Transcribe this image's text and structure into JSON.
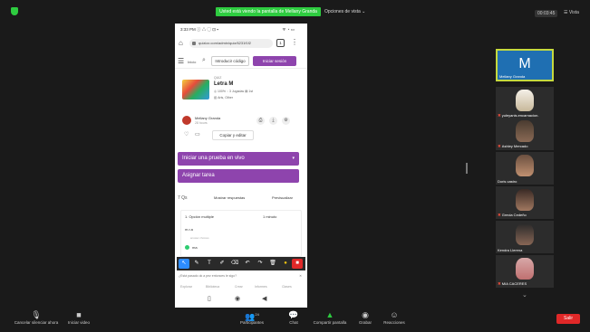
{
  "topbar": {
    "banner": "Usted está viendo la pantalla de Mellany Granda",
    "view_options": "Opciones de vista ⌄",
    "clock": "00:03:45",
    "view_btn": "☰ Vista"
  },
  "phone": {
    "status_time": "3:33 PM ⓘ △ ◯ ⊡ ▪",
    "status_right": "ᯤ ◔ ▭",
    "url": "quizizz.com/admin/quiz/6231f1f2",
    "tab_count": "1",
    "app": {
      "inicio": "Inicio",
      "code_btn": "Introducir código",
      "login_btn": "Iniciar sesión"
    },
    "quiz": {
      "type": "QUIZ",
      "title": "Letra M",
      "meta": "◎ 100%   ◌ 3 Jugadas   ▤ 1st",
      "subject": "▥ Arts, Other"
    },
    "author": {
      "name": "Mellany Granda",
      "time": "28 hours"
    },
    "copy_btn": "Copiar y editar",
    "live_btn": "Iniciar una prueba en vivo",
    "assign_btn": "Asignar tarea",
    "q_count": "7 Qs",
    "show_answers": "Mostrar respuestas",
    "preview": "Previsualizar",
    "question": {
      "type": "1. Opción multiple",
      "time": "1 minuto",
      "text": "m.r.a",
      "sub": "answer choices",
      "answer": "ma"
    },
    "ok_text": "¿Está pasado ok a pez entonces le sigo?",
    "nav": [
      "Explorar",
      "Biblioteca",
      "Crear",
      "Informes",
      "Clases"
    ]
  },
  "participants": [
    {
      "name": "Mellany Granda",
      "initial": "M",
      "mic_off": false
    },
    {
      "name": "yuleyanis.encarnacion.",
      "mic_off": true
    },
    {
      "name": "Ashley Mercado",
      "mic_off": true
    },
    {
      "name": "Doris castro",
      "mic_off": false
    },
    {
      "name": "Grecia Cedeño",
      "mic_off": true
    },
    {
      "name": "Kendra Llerena",
      "mic_off": false
    },
    {
      "name": "MIA CACERES",
      "mic_off": true
    }
  ],
  "toolbar": {
    "mute": "Cancelar silenciar ahora",
    "video": "Iniciar video",
    "participants": "Participantes",
    "participants_count": "24",
    "chat": "Chat",
    "share": "Compartir pantalla",
    "record": "Grabar",
    "reactions": "Reacciones",
    "leave": "Salir"
  },
  "colors": {
    "accent_purple": "#8e44ad",
    "share_green": "#2ecc40",
    "leave_red": "#e02828",
    "highlight_yellow": "#c5d93e"
  }
}
